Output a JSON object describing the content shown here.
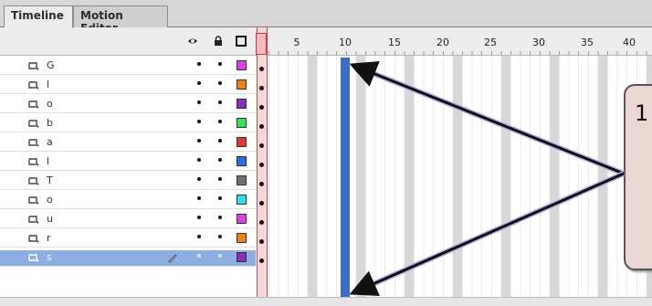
{
  "tabs": {
    "timeline": "Timeline",
    "motion_editor": "Motion Editor"
  },
  "header": {
    "show_hide_icon": "eye-icon",
    "lock_icon": "lock-icon",
    "outline_icon": "outline-square-icon"
  },
  "ruler": {
    "numbers": [
      "5",
      "10",
      "15",
      "20",
      "25",
      "30",
      "35",
      "40"
    ]
  },
  "layers": [
    {
      "name": "G",
      "color": "#e040e0"
    },
    {
      "name": "l",
      "color": "#f08010"
    },
    {
      "name": "o",
      "color": "#8a2cc0"
    },
    {
      "name": "b",
      "color": "#38e050"
    },
    {
      "name": "a",
      "color": "#e03838"
    },
    {
      "name": "l",
      "color": "#2c6ee8"
    },
    {
      "name": "T",
      "color": "#707070"
    },
    {
      "name": "o",
      "color": "#30e0e8"
    },
    {
      "name": "u",
      "color": "#e040e0"
    },
    {
      "name": "r",
      "color": "#f08010"
    },
    {
      "name": "s",
      "color": "#8a2cc0",
      "selected": true
    }
  ],
  "callout": {
    "text": "1"
  },
  "colors": {
    "selected_row": "#8daee3",
    "frame_highlight": "#3a6dc9",
    "playhead": "#c84848"
  }
}
